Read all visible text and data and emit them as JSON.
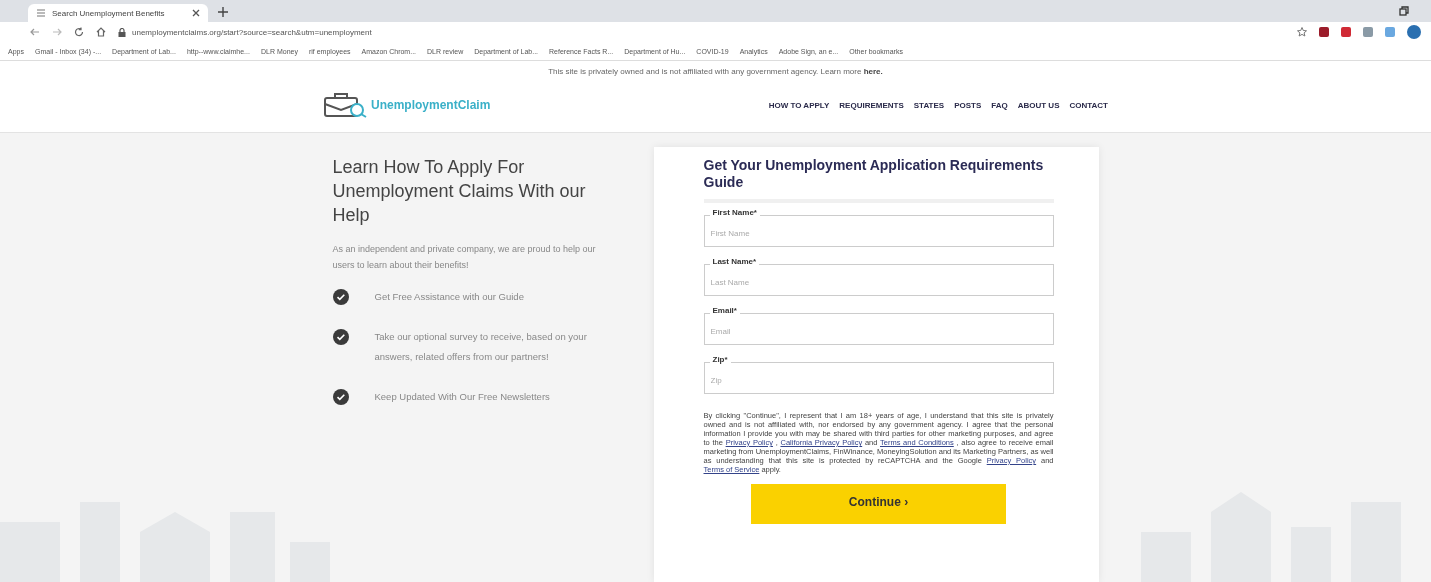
{
  "browser": {
    "tab_title": "Search Unemployment Benefits",
    "url": "unemploymentclaims.org/start?source=search&utm=unemployment",
    "bookmarks": [
      "Apps",
      "Gmail - Inbox (34) -...",
      "Department of Lab...",
      "http--www.claimhe...",
      "DLR Money",
      "rif employees",
      "Amazon Chrom...",
      "DLR review",
      "Department of Lab...",
      "Reference Facts R...",
      "Department of Hu...",
      "COVID-19",
      "Analytics",
      "Adobe Sign, an e...",
      "Other bookmarks"
    ]
  },
  "disclaimer": {
    "text": "This site is privately owned and is not affiliated with any government agency. Learn more",
    "link": "here."
  },
  "header": {
    "logo_text": "UnemploymentClaim",
    "nav": [
      "HOW TO APPLY",
      "REQUIREMENTS",
      "STATES",
      "POSTS",
      "FAQ",
      "ABOUT US",
      "CONTACT"
    ]
  },
  "intro": {
    "heading": "Learn How To Apply For Unemployment Claims With our Help",
    "paragraph": "As an independent and private company, we are proud to help our users to learn about their benefits!",
    "features": [
      "Get Free Assistance with our Guide",
      "Take our optional survey to receive, based on your answers, related offers from our partners!",
      "Keep Updated With Our Free Newsletters"
    ]
  },
  "form": {
    "title": "Get Your Unemployment Application Requirements Guide",
    "fields": [
      {
        "label": "First Name*",
        "placeholder": "First Name"
      },
      {
        "label": "Last Name*",
        "placeholder": "Last Name"
      },
      {
        "label": "Email*",
        "placeholder": "Email"
      },
      {
        "label": "Zip*",
        "placeholder": "Zip"
      }
    ],
    "consent": [
      {
        "kind": "text",
        "text": "By clicking \"Continue\", I represent that I am 18+ years of age, I understand that this site is privately owned and is not affiliated with, nor endorsed by any government agency. I agree that the personal information I provide you with may be shared with third parties for other marketing purposes, and agree to the"
      },
      {
        "kind": "link",
        "text": "Privacy Policy"
      },
      {
        "kind": "text",
        "text": ","
      },
      {
        "kind": "link",
        "text": "California Privacy Policy"
      },
      {
        "kind": "text",
        "text": "and"
      },
      {
        "kind": "link",
        "text": "Terms and Conditions"
      },
      {
        "kind": "text",
        "text": ", also agree to receive email marketing from UnemploymentClaims, FinWinance, MoneyingSolution and its Marketing Partners, as well as understanding that this site is protected by reCAPTCHA and the Google"
      },
      {
        "kind": "link",
        "text": "Privacy Policy"
      },
      {
        "kind": "text",
        "text": "and"
      },
      {
        "kind": "link",
        "text": "Terms of Service"
      },
      {
        "kind": "text",
        "text": "apply."
      }
    ],
    "button": "Continue ›"
  }
}
